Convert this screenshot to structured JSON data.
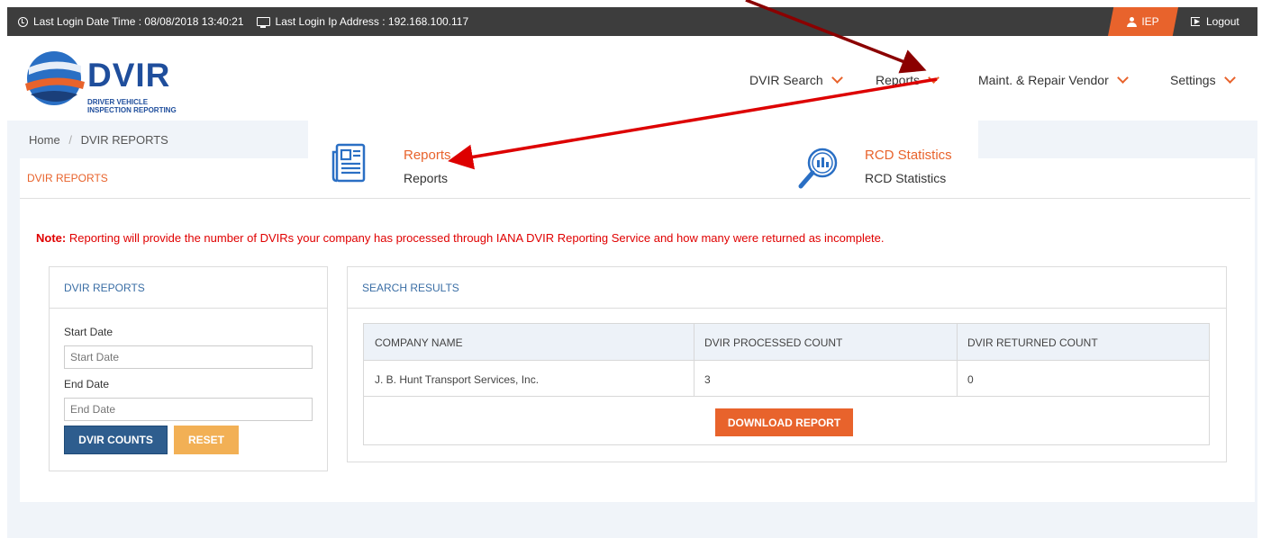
{
  "topbar": {
    "last_login_time": "Last Login Date Time : 08/08/2018 13:40:21",
    "last_login_ip": "Last Login Ip Address : 192.168.100.117",
    "user": "IEP",
    "logout": "Logout"
  },
  "logo": {
    "word": "DVIR",
    "sub_line1": "DRIVER VEHICLE",
    "sub_line2": "INSPECTION REPORTING"
  },
  "nav": {
    "dvir_search": "DVIR Search",
    "reports": "Reports",
    "vendor": "Maint. & Repair Vendor",
    "settings": "Settings"
  },
  "dropdown": {
    "items": [
      {
        "title": "Reports",
        "subtitle": "Reports",
        "icon": "newspaper-icon"
      },
      {
        "title": "RCD Statistics",
        "subtitle": "RCD Statistics",
        "icon": "magnifier-chart-icon"
      }
    ]
  },
  "breadcrumb": {
    "home": "Home",
    "separator": "/",
    "current": "DVIR REPORTS"
  },
  "panel": {
    "title": "DVIR REPORTS"
  },
  "note": {
    "label": "Note:",
    "text": "Reporting will provide the number of DVIRs your company has processed through IANA DVIR Reporting Service and how many were returned as incomplete."
  },
  "filter": {
    "title": "DVIR REPORTS",
    "start_label": "Start Date",
    "start_placeholder": "Start Date",
    "end_label": "End Date",
    "end_placeholder": "End Date",
    "counts_button": "DVIR COUNTS",
    "reset_button": "RESET"
  },
  "results": {
    "title": "SEARCH RESULTS",
    "columns": [
      "COMPANY NAME",
      "DVIR PROCESSED COUNT",
      "DVIR RETURNED COUNT"
    ],
    "rows": [
      [
        "J. B. Hunt Transport Services, Inc.",
        "3",
        "0"
      ]
    ],
    "download_button": "DOWNLOAD REPORT"
  },
  "colors": {
    "accent": "#e8632c",
    "brand_blue": "#1f4e9c",
    "topbar": "#3d3d3d",
    "note_red": "#e00000",
    "annotation_arrow": "#cc0000"
  }
}
